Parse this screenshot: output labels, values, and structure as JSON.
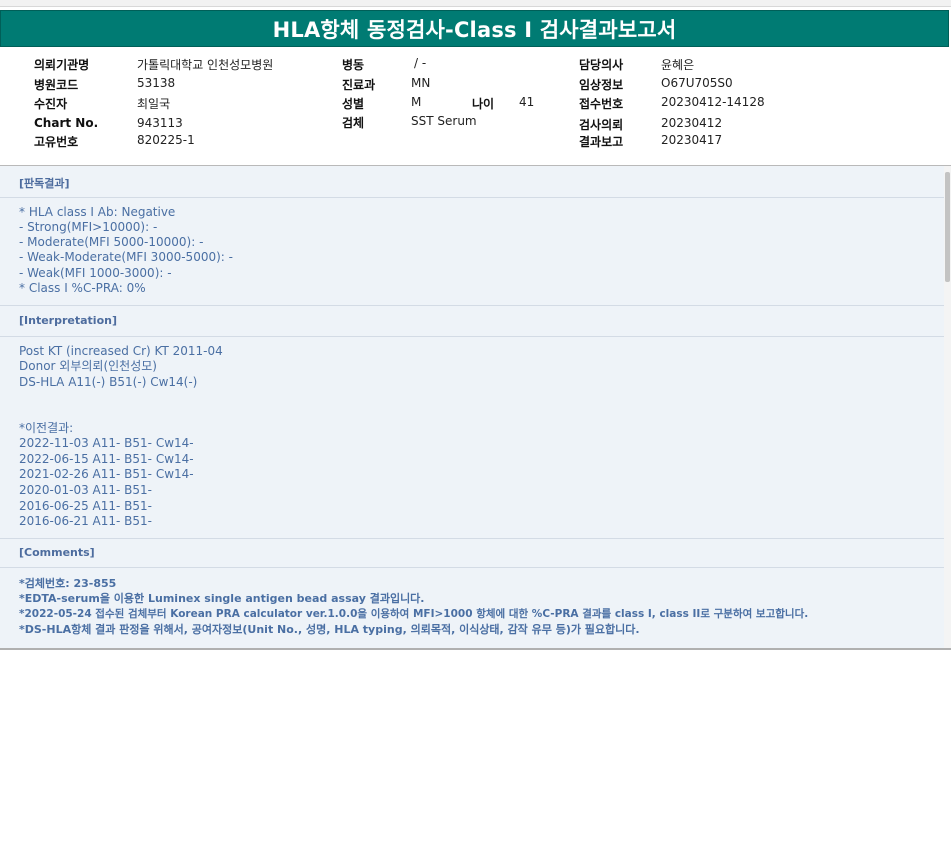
{
  "title": "HLA항체 동정검사-Class I 검사결과보고서",
  "info": {
    "labels": {
      "institution": "의뢰기관명",
      "hospital_code": "병원코드",
      "recipient": "수진자",
      "chart_no": "Chart No.",
      "unique_no": "고유번호",
      "ward": "병동",
      "department": "진료과",
      "sex": "성별",
      "age": "나이",
      "specimen": "검체",
      "physician": "담당의사",
      "clinical_info": "임상정보",
      "accession_no": "접수번호",
      "request_date": "검사의뢰",
      "report_date": "결과보고"
    },
    "values": {
      "institution": "가톨릭대학교 인천성모병원",
      "hospital_code": "53138",
      "recipient": "최일국",
      "chart_no": "943113",
      "unique_no": "820225-1",
      "ward": "/ -",
      "department": "MN",
      "sex": "M",
      "age": "41",
      "specimen": "SST Serum",
      "physician": "윤혜은",
      "clinical_info": "O67U705S0",
      "accession_no": "20230412-14128",
      "request_date": "20230412",
      "report_date": "20230417"
    }
  },
  "sections": {
    "judgment": {
      "header": "[판독결과]",
      "lines": [
        "* HLA class I Ab: Negative",
        "- Strong(MFI>10000): -",
        "- Moderate(MFI 5000-10000): -",
        "- Weak-Moderate(MFI 3000-5000): -",
        "- Weak(MFI 1000-3000): -",
        "* Class I %C-PRA: 0%"
      ]
    },
    "interpretation": {
      "header": "[Interpretation]",
      "lines": [
        "Post KT (increased Cr) KT 2011-04",
        "Donor 외부의뢰(인천성모)",
        "DS-HLA A11(-) B51(-) Cw14(-)"
      ],
      "previous_header": "*이전결과:",
      "previous": [
        "2022-11-03 A11- B51- Cw14-",
        "2022-06-15 A11- B51- Cw14-",
        "2021-02-26 A11- B51- Cw14-",
        "2020-01-03 A11- B51-",
        "2016-06-25 A11- B51-",
        "2016-06-21 A11- B51-"
      ]
    },
    "comments": {
      "header": "[Comments]",
      "lines": [
        "*검체번호: 23-855",
        "*EDTA-serum을 이용한 Luminex single antigen bead assay 결과입니다.",
        "*2022-05-24 접수된 검체부터 Korean PRA calculator ver.1.0.0을 이용하여 MFI>1000 항체에 대한 %C-PRA 결과를 class I, class II로 구분하여 보고합니다.",
        "*DS-HLA항체 결과 판정을 위해서, 공여자정보(Unit No., 성명, HLA typing, 의뢰목적, 이식상태, 감작 유무 등)가 필요합니다."
      ]
    }
  },
  "colors": {
    "title_bg": "#007b73",
    "content_bg": "#eef3f8",
    "content_text": "#4a6fa3"
  }
}
